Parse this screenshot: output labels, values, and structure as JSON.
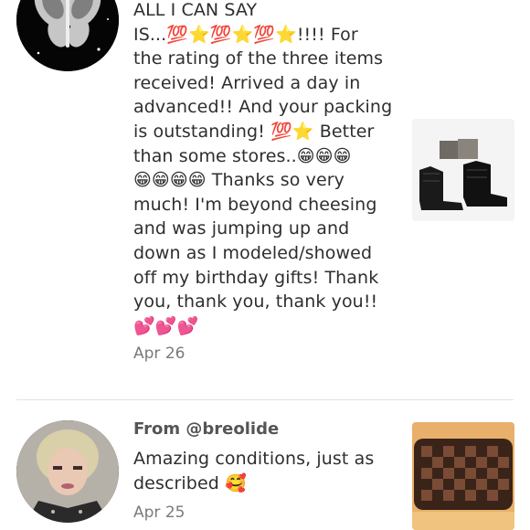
{
  "reviews": [
    {
      "lines": [
        "ALL I CAN SAY",
        "IS...💯⭐💯⭐💯⭐!!!! For",
        "the rating of the three items",
        "received! Arrived a day in",
        "advanced!! And your packing",
        "is outstanding! 💯⭐ Better",
        "than some stores..😁😁😁",
        "😁😁😁😁 Thanks so very",
        "much! I'm beyond cheesing",
        "and was jumping up and",
        "down as I modeled/showed",
        "off my birthday gifts! Thank",
        "you, thank you, thank you!!",
        "💕💕💕"
      ],
      "date": "Apr 26",
      "avatar_icon": "butterfly-avatar",
      "thumb_icon": "black-boots-photo"
    },
    {
      "from": "From @breolide",
      "lines": [
        "Amazing conditions, just as",
        "described 🥰"
      ],
      "date": "Apr 25",
      "avatar_icon": "woman-avatar",
      "thumb_icon": "damier-wallet-photo"
    }
  ]
}
